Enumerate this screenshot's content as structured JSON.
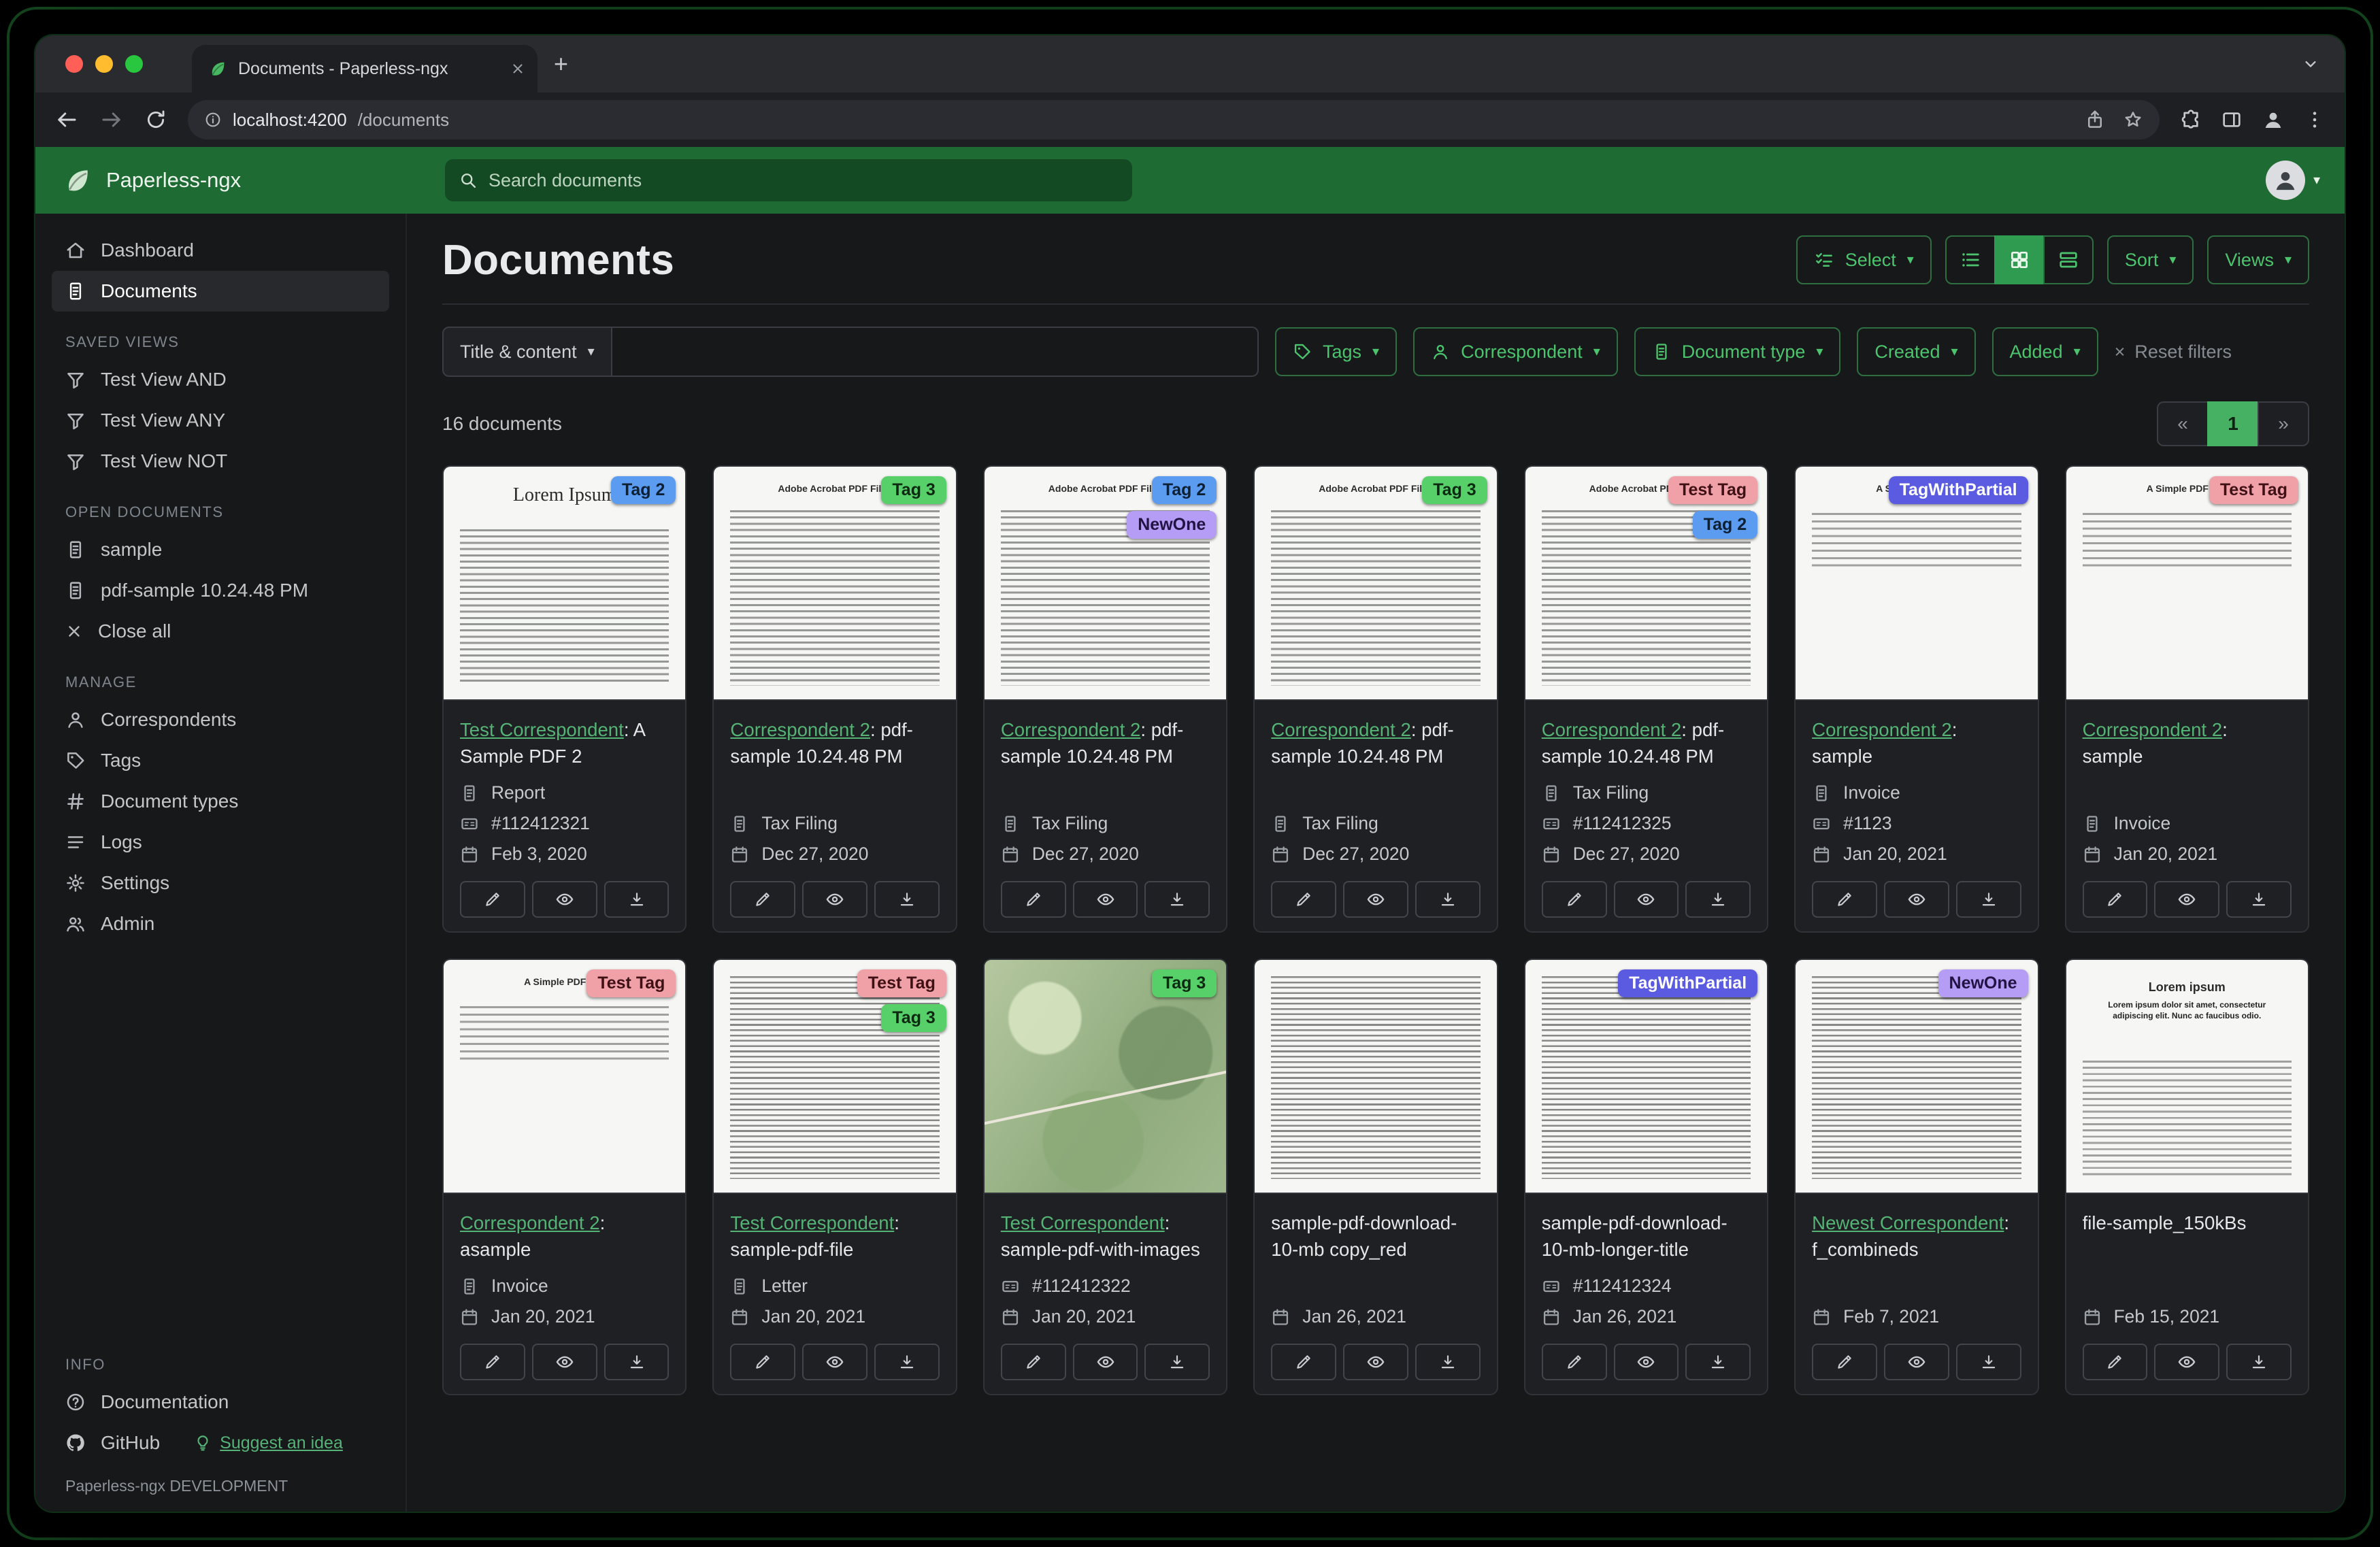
{
  "browser": {
    "tab_title": "Documents - Paperless-ngx",
    "url_host": "localhost:4200",
    "url_path": "/documents"
  },
  "glyphs": {
    "caret": "▾",
    "plus": "+",
    "reset_x": "×",
    "close_x": "×"
  },
  "app_header": {
    "brand": "Paperless-ngx",
    "search_placeholder": "Search documents"
  },
  "sidebar": {
    "dashboard": "Dashboard",
    "documents": "Documents",
    "saved_views_title": "SAVED VIEWS",
    "saved_views": [
      "Test View AND",
      "Test View ANY",
      "Test View NOT"
    ],
    "open_documents_title": "OPEN DOCUMENTS",
    "open_documents": [
      "sample",
      "pdf-sample 10.24.48 PM"
    ],
    "close_all": "Close all",
    "manage_title": "MANAGE",
    "manage": [
      "Correspondents",
      "Tags",
      "Document types",
      "Logs",
      "Settings",
      "Admin"
    ],
    "info_title": "INFO",
    "documentation": "Documentation",
    "github": "GitHub",
    "suggest": "Suggest an idea",
    "version": "Paperless-ngx DEVELOPMENT"
  },
  "toolbar": {
    "title": "Documents",
    "select": "Select",
    "sort": "Sort",
    "views": "Views"
  },
  "filters": {
    "field": "Title & content",
    "query_value": "",
    "tags": "Tags",
    "correspondent": "Correspondent",
    "document_type": "Document type",
    "created": "Created",
    "added": "Added",
    "reset": "Reset filters"
  },
  "results": {
    "count": "16 documents",
    "prev": "«",
    "page": "1",
    "next": "»"
  },
  "thumb_headings": {
    "lorem": "Lorem Ipsum",
    "acrobat": "Adobe Acrobat PDF Files",
    "simple": "A Simple PDF File",
    "lorem2": "Lorem ipsum",
    "lorem2_sub": "Lorem ipsum dolor sit amet, consectetur adipiscing elit. Nunc ac faucibus odio."
  },
  "cards": [
    {
      "tags": [
        {
          "label": "Tag 2",
          "bg": "#5b9cf0",
          "fg": "#0d2034"
        }
      ],
      "link": "Test Correspondent",
      "rest": ": A Sample PDF 2",
      "type": "Report",
      "asn": "#112412321",
      "date": "Feb 3, 2020",
      "thumb": "lorem"
    },
    {
      "tags": [
        {
          "label": "Tag 3",
          "bg": "#58d06a",
          "fg": "#0c2a11"
        }
      ],
      "link": "Correspondent 2",
      "rest": ": pdf-sample 10.24.48 PM",
      "type": "Tax Filing",
      "asn": "",
      "date": "Dec 27, 2020",
      "thumb": "acrobat"
    },
    {
      "tags": [
        {
          "label": "Tag 2",
          "bg": "#5b9cf0",
          "fg": "#0d2034"
        },
        {
          "label": "NewOne",
          "bg": "#b59df5",
          "fg": "#231345"
        }
      ],
      "link": "Correspondent 2",
      "rest": ": pdf-sample 10.24.48 PM",
      "type": "Tax Filing",
      "asn": "",
      "date": "Dec 27, 2020",
      "thumb": "acrobat"
    },
    {
      "tags": [
        {
          "label": "Tag 3",
          "bg": "#58d06a",
          "fg": "#0c2a11"
        }
      ],
      "link": "Correspondent 2",
      "rest": ": pdf-sample 10.24.48 PM",
      "type": "Tax Filing",
      "asn": "",
      "date": "Dec 27, 2020",
      "thumb": "acrobat"
    },
    {
      "tags": [
        {
          "label": "Test Tag",
          "bg": "#f0a1a8",
          "fg": "#3f1115"
        },
        {
          "label": "Tag 2",
          "bg": "#5b9cf0",
          "fg": "#0d2034"
        }
      ],
      "link": "Correspondent 2",
      "rest": ": pdf-sample 10.24.48 PM",
      "type": "Tax Filing",
      "asn": "#112412325",
      "date": "Dec 27, 2020",
      "thumb": "acrobat"
    },
    {
      "tags": [
        {
          "label": "TagWithPartial",
          "bg": "#5a5be0",
          "fg": "#ffffff"
        }
      ],
      "link": "Correspondent 2",
      "rest": ": sample",
      "type": "Invoice",
      "asn": "#1123",
      "date": "Jan 20, 2021",
      "thumb": "simple"
    },
    {
      "tags": [
        {
          "label": "Test Tag",
          "bg": "#f0a1a8",
          "fg": "#3f1115"
        }
      ],
      "link": "Correspondent 2",
      "rest": ": sample",
      "type": "Invoice",
      "asn": "",
      "date": "Jan 20, 2021",
      "thumb": "simple"
    },
    {
      "tags": [
        {
          "label": "Test Tag",
          "bg": "#f0a1a8",
          "fg": "#3f1115"
        }
      ],
      "link": "Correspondent 2",
      "rest": ": asample",
      "type": "Invoice",
      "asn": "",
      "date": "Jan 20, 2021",
      "thumb": "simple"
    },
    {
      "tags": [
        {
          "label": "Test Tag",
          "bg": "#f0a1a8",
          "fg": "#3f1115"
        },
        {
          "label": "Tag 3",
          "bg": "#58d06a",
          "fg": "#0c2a11"
        }
      ],
      "link": "Test Correspondent",
      "rest": ": sample-pdf-file",
      "type": "Letter",
      "asn": "",
      "date": "Jan 20, 2021",
      "thumb": "dense"
    },
    {
      "tags": [
        {
          "label": "Tag 3",
          "bg": "#58d06a",
          "fg": "#0c2a11"
        }
      ],
      "link": "Test Correspondent",
      "rest": ": sample-pdf-with-images",
      "type": "",
      "asn": "#112412322",
      "date": "Jan 20, 2021",
      "thumb": "map"
    },
    {
      "tags": [],
      "link": "",
      "rest": "sample-pdf-download-10-mb copy_red",
      "type": "",
      "asn": "",
      "date": "Jan 26, 2021",
      "thumb": "dense"
    },
    {
      "tags": [
        {
          "label": "TagWithPartial",
          "bg": "#5a5be0",
          "fg": "#ffffff"
        }
      ],
      "link": "",
      "rest": "sample-pdf-download-10-mb-longer-title",
      "type": "",
      "asn": "#112412324",
      "date": "Jan 26, 2021",
      "thumb": "dense"
    },
    {
      "tags": [
        {
          "label": "NewOne",
          "bg": "#b59df5",
          "fg": "#231345"
        }
      ],
      "link": "Newest Correspondent",
      "rest": ": f_combineds",
      "type": "",
      "asn": "",
      "date": "Feb 7, 2021",
      "thumb": "dense"
    },
    {
      "tags": [],
      "link": "",
      "rest": "file-sample_150kBs",
      "type": "",
      "asn": "",
      "date": "Feb 15, 2021",
      "thumb": "lorem2"
    }
  ]
}
